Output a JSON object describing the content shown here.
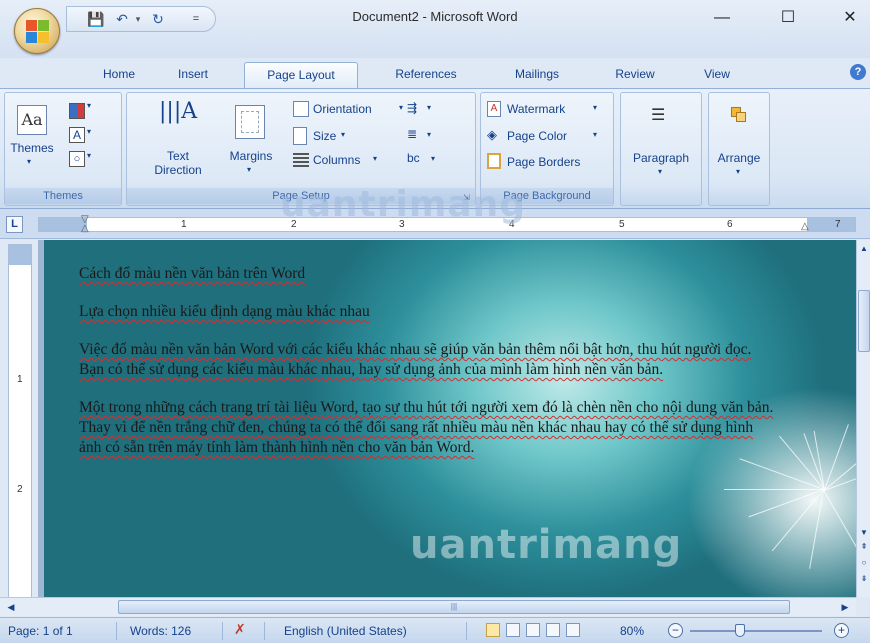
{
  "window": {
    "title": "Document2 - Microsoft Word",
    "minimize": "—",
    "maximize": "☐",
    "close": "✕"
  },
  "qat": {
    "save": "💾",
    "undo": "↶",
    "redo": "↻",
    "customize": "⇣"
  },
  "tabs": [
    {
      "label": "Home"
    },
    {
      "label": "Insert"
    },
    {
      "label": "Page Layout",
      "active": true
    },
    {
      "label": "References"
    },
    {
      "label": "Mailings"
    },
    {
      "label": "Review"
    },
    {
      "label": "View"
    }
  ],
  "ribbon": {
    "themes": {
      "button": "Themes",
      "group_label": "Themes"
    },
    "page_setup": {
      "text_direction_1": "Text",
      "text_direction_2": "Direction",
      "margins": "Margins",
      "orientation": "Orientation",
      "size": "Size",
      "columns": "Columns",
      "group_label": "Page Setup"
    },
    "page_background": {
      "watermark": "Watermark",
      "page_color": "Page Color",
      "page_borders": "Page Borders",
      "group_label": "Page Background"
    },
    "paragraph": {
      "label": "Paragraph"
    },
    "arrange": {
      "label": "Arrange"
    }
  },
  "ruler": {
    "corner": "L",
    "numbers": [
      "1",
      "2",
      "3",
      "4",
      "5",
      "6",
      "7"
    ],
    "vnumbers": [
      "1",
      "2"
    ]
  },
  "document": {
    "paragraphs": [
      "Cách đổ màu nền văn bản trên Word",
      "Lựa chọn nhiều kiểu định dạng màu khác nhau",
      "Việc đổ màu nền văn bản Word với các kiểu khác nhau sẽ giúp văn bản thêm nổi bật hơn, thu hút người đọc. Bạn có thể sử dụng các kiểu màu khác nhau, hay sử dụng ảnh của mình làm hình nền văn bản.",
      "Một trong những cách trang trí tài liệu Word, tạo sự thu hút tới người xem đó là chèn nền cho nội dung văn bản. Thay vì để nền trắng chữ đen, chúng ta có thể đổi sang rất nhiều màu nền khác nhau hay có thể sử dụng hình ảnh có sẵn trên máy tính làm thành hình nền cho văn bản Word."
    ]
  },
  "watermark_text": "uantrimang",
  "status_bar": {
    "page": "Page: 1 of 1",
    "words": "Words: 126",
    "language": "English (United States)",
    "zoom": "80%",
    "zoom_out": "−",
    "zoom_in": "+"
  },
  "colors": {
    "ribbon_text": "#15428b",
    "accent": "#3e6aaa",
    "page_bg_teal": "#2d8f9b"
  }
}
